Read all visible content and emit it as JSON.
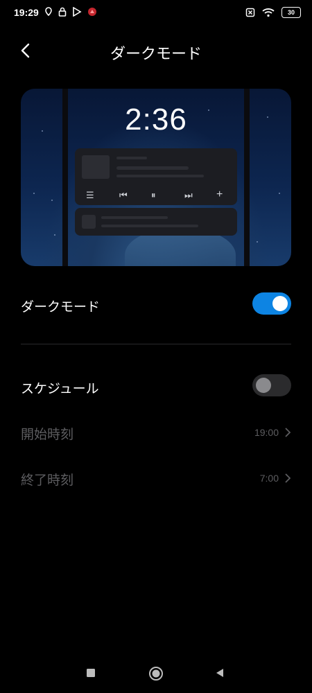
{
  "status_bar": {
    "time": "19:29",
    "battery": "30",
    "icons_left": [
      "location-icon",
      "lock-icon",
      "play-store-icon",
      "app-notification-icon"
    ],
    "icons_right": [
      "sim-off-icon",
      "wifi-icon",
      "battery-icon"
    ]
  },
  "header": {
    "title": "ダークモード",
    "back_icon": "chevron-left-icon"
  },
  "preview": {
    "clock": "2:36"
  },
  "settings": {
    "dark_mode": {
      "label": "ダークモード",
      "enabled": true
    },
    "schedule": {
      "label": "スケジュール",
      "enabled": false
    },
    "start_time": {
      "label": "開始時刻",
      "value": "19:00"
    },
    "end_time": {
      "label": "終了時刻",
      "value": "7:00"
    }
  },
  "colors": {
    "accent": "#0d84e3",
    "background": "#000000",
    "disabled_text": "#5d5d60"
  },
  "nav_bar": {
    "icons": [
      "recents-square-icon",
      "home-circle-icon",
      "back-triangle-icon"
    ]
  }
}
